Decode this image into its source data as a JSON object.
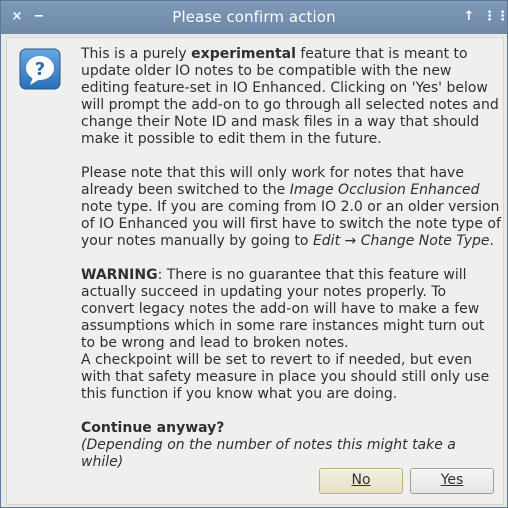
{
  "window": {
    "title": "Please confirm action",
    "controls": {
      "close": "×",
      "minimize": "−",
      "up": "↑",
      "grid": "⋮⋮"
    }
  },
  "icon": {
    "name": "question-icon",
    "symbol": "?"
  },
  "message": {
    "p1": {
      "a": "This is a purely ",
      "b": "experimental",
      "c": " feature that is meant to update older IO notes to be compatible with the new editing feature-set in IO Enhanced. Clicking on 'Yes' below will prompt the add-on to go through all selected notes and change their Note ID and mask files in a way that should make it possible to edit them in the future."
    },
    "p2": {
      "a": "Please note that this will only work for notes that have already been switched to the ",
      "b": "Image Occlusion Enhanced",
      "c": " note type. If you are coming from IO 2.0 or an older version of IO Enhanced you will first have to switch the note type of your notes manually by going to ",
      "d": "Edit",
      "e": " → ",
      "f": "Change Note Type",
      "g": "."
    },
    "p3": {
      "a": "WARNING",
      "b": ": There is no guarantee that this feature will actually succeed in updating your notes properly. To convert legacy notes the add-on will have to make a few assumptions which in some rare instances might turn out to be wrong and lead to broken notes."
    },
    "p4": "A checkpoint will be set to revert to if needed, but even with that safety measure in place you should still only use this function if you know what you are doing.",
    "p5": {
      "question": "Continue anyway?",
      "note": "(Depending on the number of notes this might take a while)"
    }
  },
  "buttons": {
    "no": "No",
    "yes": "Yes"
  }
}
